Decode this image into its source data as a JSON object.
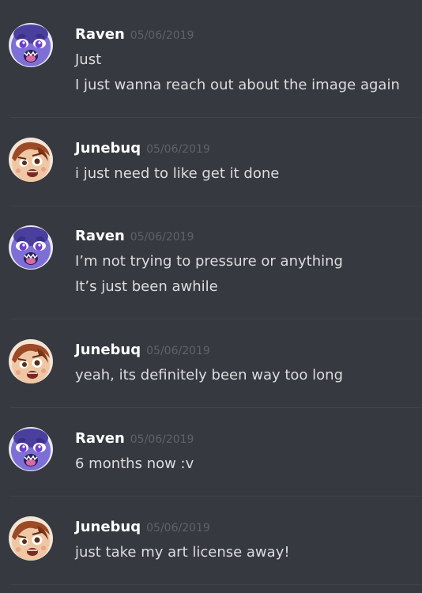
{
  "messages": [
    {
      "author": "Raven",
      "avatar": "raven-avatar",
      "timestamp": "05/06/2019",
      "lines": [
        "Just",
        "I just wanna reach out about the image again"
      ]
    },
    {
      "author": "Junebuq",
      "avatar": "junebuq-avatar",
      "timestamp": "05/06/2019",
      "lines": [
        "i just need to like get it done"
      ]
    },
    {
      "author": "Raven",
      "avatar": "raven-avatar",
      "timestamp": "05/06/2019",
      "lines": [
        "I’m not trying to pressure or anything",
        "It’s just been awhile"
      ]
    },
    {
      "author": "Junebuq",
      "avatar": "junebuq-avatar",
      "timestamp": "05/06/2019",
      "lines": [
        "yeah, its definitely been way too long"
      ]
    },
    {
      "author": "Raven",
      "avatar": "raven-avatar",
      "timestamp": "05/06/2019",
      "lines": [
        "6 months now :v"
      ]
    },
    {
      "author": "Junebuq",
      "avatar": "junebuq-avatar",
      "timestamp": "05/06/2019",
      "lines": [
        "just take my art license away!"
      ]
    }
  ],
  "colors": {
    "background": "#36393f",
    "author": "#ffffff",
    "message_text": "#dcddde",
    "timestamp": "#5f6269",
    "divider": "#40434a"
  }
}
